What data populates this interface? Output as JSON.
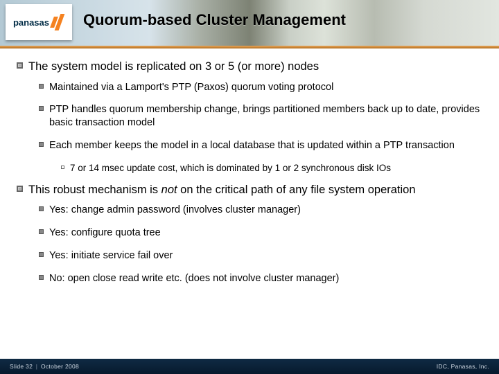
{
  "logo": {
    "text": "panasas"
  },
  "title": "Quorum-based Cluster Management",
  "bullets": {
    "b1": "The system model is replicated on 3 or 5 (or more) nodes",
    "b1_1": "Maintained via a Lamport's PTP (Paxos) quorum voting protocol",
    "b1_2": "PTP handles quorum membership change, brings partitioned members back up to date, provides basic transaction model",
    "b1_3": "Each member keeps the model in a local database that is updated within a PTP transaction",
    "b1_3_1": "7 or 14 msec update cost, which is dominated by 1 or 2 synchronous disk IOs",
    "b2_pre": "This robust mechanism is ",
    "b2_em": "not",
    "b2_post": " on the critical path of any file system operation",
    "b2_1": "Yes: change admin password (involves cluster manager)",
    "b2_2": "Yes: configure quota tree",
    "b2_3": "Yes: initiate service fail over",
    "b2_4": "No: open close read write etc. (does not involve cluster manager)"
  },
  "footer": {
    "slide": "Slide 32",
    "date": "October 2008",
    "right": "IDC, Panasas, Inc."
  }
}
